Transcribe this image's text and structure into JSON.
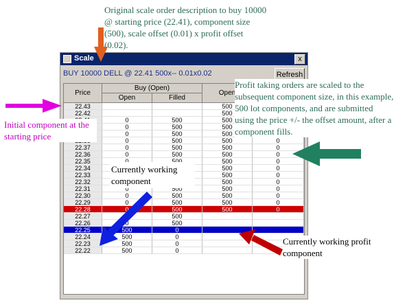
{
  "annotations": {
    "top": "Original scale order description to buy 10000 @ starting price (22.41), component size (500), scale offset (0.01) x profit offset (0.02).",
    "initial": "Initial component at the starting price",
    "profit": "Profit taking orders are scaled to the subsequent component size, in this example, 500 lot components, and are submitted using the price +/- the offset amount, after a component fills.",
    "working": "Currently working component",
    "profit_working": "Currently working profit component"
  },
  "window": {
    "title": "Scale",
    "close_label": "x",
    "description": "BUY 10000 DELL  @ 22.41 500x-- 0.01x0.02",
    "refresh_label": "Refresh"
  },
  "columns": {
    "price": "Price",
    "buy_group": "Buy (Open)",
    "open": "Open",
    "filled": "Filled",
    "profit_open": "Open"
  },
  "rows": [
    {
      "price": "22.43",
      "open": "",
      "filled": "",
      "p1": "500",
      "p2": "0"
    },
    {
      "price": "22.42",
      "open": "",
      "filled": "",
      "p1": "500",
      "p2": "0"
    },
    {
      "price": "22.41",
      "open": "0",
      "filled": "500",
      "p1": "500",
      "p2": "0"
    },
    {
      "price": "22.40",
      "open": "0",
      "filled": "500",
      "p1": "500",
      "p2": "0"
    },
    {
      "price": "22.39",
      "open": "0",
      "filled": "500",
      "p1": "500",
      "p2": "0"
    },
    {
      "price": "22.38",
      "open": "0",
      "filled": "500",
      "p1": "500",
      "p2": "0"
    },
    {
      "price": "22.37",
      "open": "0",
      "filled": "500",
      "p1": "500",
      "p2": "0"
    },
    {
      "price": "22.36",
      "open": "0",
      "filled": "500",
      "p1": "500",
      "p2": "0"
    },
    {
      "price": "22.35",
      "open": "0",
      "filled": "500",
      "p1": "500",
      "p2": "0"
    },
    {
      "price": "22.34",
      "open": "0",
      "filled": "500",
      "p1": "500",
      "p2": "0"
    },
    {
      "price": "22.33",
      "open": "0",
      "filled": "500",
      "p1": "500",
      "p2": "0"
    },
    {
      "price": "22.32",
      "open": "0",
      "filled": "500",
      "p1": "500",
      "p2": "0"
    },
    {
      "price": "22.31",
      "open": "0",
      "filled": "500",
      "p1": "500",
      "p2": "0"
    },
    {
      "price": "22.30",
      "open": "0",
      "filled": "500",
      "p1": "500",
      "p2": "0"
    },
    {
      "price": "22.29",
      "open": "0",
      "filled": "500",
      "p1": "500",
      "p2": "0"
    },
    {
      "price": "22.28",
      "open": "0",
      "filled": "500",
      "p1": "500",
      "p2": "0",
      "style": "red"
    },
    {
      "price": "22.27",
      "open": "0",
      "filled": "500",
      "p1": "",
      "p2": ""
    },
    {
      "price": "22.26",
      "open": "0",
      "filled": "500",
      "p1": "",
      "p2": ""
    },
    {
      "price": "22.25",
      "open": "500",
      "filled": "0",
      "p1": "",
      "p2": "",
      "style": "blue"
    },
    {
      "price": "22.24",
      "open": "500",
      "filled": "0",
      "p1": "",
      "p2": ""
    },
    {
      "price": "22.23",
      "open": "500",
      "filled": "0",
      "p1": "",
      "p2": ""
    },
    {
      "price": "22.22",
      "open": "500",
      "filled": "0",
      "p1": "",
      "p2": ""
    }
  ],
  "arrow_colors": {
    "orange": "#e06020",
    "magenta": "#e000e0",
    "green": "#208060",
    "blue": "#1020e0",
    "red": "#c00000"
  }
}
